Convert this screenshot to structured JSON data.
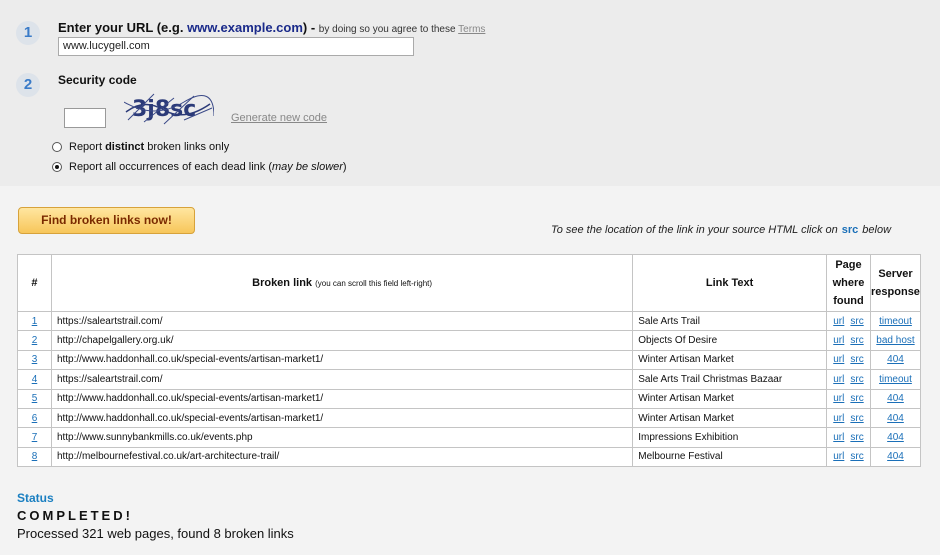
{
  "form": {
    "step1": "1",
    "step2": "2",
    "url_label": "Enter your URL (e.g. ",
    "url_example": "www.example.com",
    "url_label_end": ") - ",
    "url_note": "by doing so you agree to these ",
    "terms_link": "Terms",
    "url_value": "www.lucygell.com",
    "security_label": "Security code",
    "captcha_text": "3j8sc",
    "generate_link": "Generate new code",
    "radio1_pre": "Report ",
    "radio1_bold": "distinct",
    "radio1_post": " broken links only",
    "radio1_checked": false,
    "radio2_pre": "Report all occurrences of each dead link (",
    "radio2_italic": "may be slower",
    "radio2_post": ")",
    "radio2_checked": true,
    "find_button": "Find broken links now!",
    "hint_pre": "To see the location of the link in your source HTML click on",
    "hint_src": "src",
    "hint_post": "below"
  },
  "table": {
    "headers": {
      "num": "#",
      "broken_link": "Broken link",
      "broken_link_note": "(you can scroll this field left-right)",
      "link_text": "Link Text",
      "page_found": [
        "Page",
        "where",
        "found"
      ],
      "server_response": [
        "Server",
        "response"
      ]
    },
    "rows": [
      {
        "num": "1",
        "link": "https://saleartstrail.com/",
        "text": "Sale Arts Trail",
        "url": "url",
        "src": "src",
        "response": "timeout"
      },
      {
        "num": "2",
        "link": "http://chapelgallery.org.uk/",
        "text": "Objects Of Desire",
        "url": "url",
        "src": "src",
        "response": "bad host"
      },
      {
        "num": "3",
        "link": "http://www.haddonhall.co.uk/special-events/artisan-market1/",
        "text": "Winter Artisan Market",
        "url": "url",
        "src": "src",
        "response": "404"
      },
      {
        "num": "4",
        "link": "https://saleartstrail.com/",
        "text": "Sale Arts Trail Christmas Bazaar",
        "url": "url",
        "src": "src",
        "response": "timeout"
      },
      {
        "num": "5",
        "link": "http://www.haddonhall.co.uk/special-events/artisan-market1/",
        "text": "Winter Artisan Market",
        "url": "url",
        "src": "src",
        "response": "404"
      },
      {
        "num": "6",
        "link": "http://www.haddonhall.co.uk/special-events/artisan-market1/",
        "text": "Winter Artisan Market",
        "url": "url",
        "src": "src",
        "response": "404"
      },
      {
        "num": "7",
        "link": "http://www.sunnybankmills.co.uk/events.php",
        "text": "Impressions Exhibition",
        "url": "url",
        "src": "src",
        "response": "404"
      },
      {
        "num": "8",
        "link": "http://melbournefestival.co.uk/art-architecture-trail/",
        "text": "Melbourne Festival",
        "url": "url",
        "src": "src",
        "response": "404"
      }
    ]
  },
  "status": {
    "heading": "Status",
    "state": "COMPLETED!",
    "summary": "Processed 321 web pages, found 8 broken links"
  }
}
